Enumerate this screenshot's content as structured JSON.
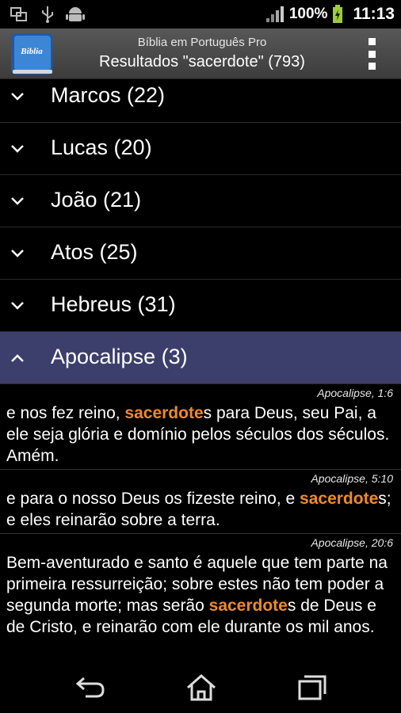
{
  "status_bar": {
    "icons": [
      "screenshot-icon",
      "usb-icon",
      "android-debug-icon"
    ],
    "battery": "100%",
    "time": "11:13"
  },
  "action_bar": {
    "app_icon_text": "Biblia",
    "subtitle": "Bíblia em Português Pro",
    "title": "Resultados \"sacerdote\"  (793)"
  },
  "groups": [
    {
      "label": "Marcos (22)",
      "expanded": false
    },
    {
      "label": "Lucas (20)",
      "expanded": false
    },
    {
      "label": "João (21)",
      "expanded": false
    },
    {
      "label": "Atos (25)",
      "expanded": false
    },
    {
      "label": "Hebreus (31)",
      "expanded": false
    },
    {
      "label": "Apocalipse (3)",
      "expanded": true
    }
  ],
  "verses": [
    {
      "ref": "Apocalipse, 1:6",
      "before": "e nos fez reino, ",
      "match": "sacerdote",
      "after": "s para Deus, seu Pai, a ele seja glória e domínio pelos séculos dos séculos. Amém."
    },
    {
      "ref": "Apocalipse, 5:10",
      "before": "e para o nosso Deus os fizeste reino, e ",
      "match": "sacerdote",
      "after": "s; e eles reinarão sobre a terra."
    },
    {
      "ref": "Apocalipse, 20:6",
      "before": "Bem-aventurado e santo é aquele que tem parte na primeira ressurreição; sobre estes não tem poder a segunda morte; mas serão ",
      "match": "sacerdote",
      "after": "s de Deus e de Cristo, e reinarão com ele durante os mil anos."
    }
  ],
  "colors": {
    "highlight": "#ee8a2c",
    "expanded_group_bg": "#3c3f6b",
    "action_bar": "#4a4a4a"
  }
}
